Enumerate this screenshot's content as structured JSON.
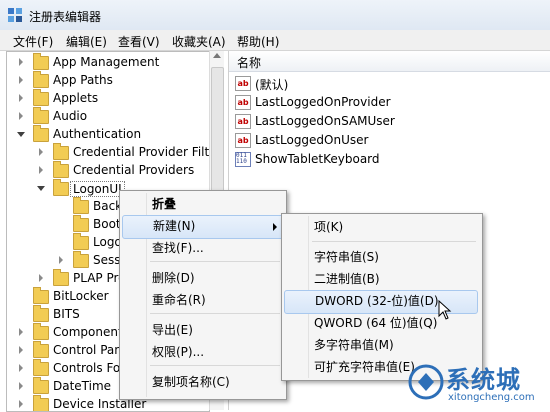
{
  "window": {
    "title": "注册表编辑器"
  },
  "menubar": [
    "文件(F)",
    "编辑(E)",
    "查看(V)",
    "收藏夹(A)",
    "帮助(H)"
  ],
  "tree": {
    "items": [
      {
        "label": "App Management",
        "level": 1,
        "state": "collapsed"
      },
      {
        "label": "App Paths",
        "level": 1,
        "state": "collapsed"
      },
      {
        "label": "Applets",
        "level": 1,
        "state": "collapsed"
      },
      {
        "label": "Audio",
        "level": 1,
        "state": "collapsed"
      },
      {
        "label": "Authentication",
        "level": 1,
        "state": "expanded"
      },
      {
        "label": "Credential Provider Filter",
        "level": 2,
        "state": "collapsed"
      },
      {
        "label": "Credential Providers",
        "level": 2,
        "state": "collapsed"
      },
      {
        "label": "LogonUI",
        "level": 2,
        "state": "expanded",
        "selected": true
      },
      {
        "label": "Back",
        "level": 3,
        "state": "none"
      },
      {
        "label": "Boot",
        "level": 3,
        "state": "none"
      },
      {
        "label": "Logo",
        "level": 3,
        "state": "none"
      },
      {
        "label": "Sessi",
        "level": 3,
        "state": "collapsed"
      },
      {
        "label": "PLAP Pro",
        "level": 2,
        "state": "collapsed"
      },
      {
        "label": "BitLocker",
        "level": 1,
        "state": "none"
      },
      {
        "label": "BITS",
        "level": 1,
        "state": "none"
      },
      {
        "label": "Component",
        "level": 1,
        "state": "collapsed"
      },
      {
        "label": "Control Pan",
        "level": 1,
        "state": "collapsed"
      },
      {
        "label": "Controls Fol",
        "level": 1,
        "state": "collapsed"
      },
      {
        "label": "DateTime",
        "level": 1,
        "state": "collapsed"
      },
      {
        "label": "Device Installer",
        "level": 1,
        "state": "collapsed"
      }
    ]
  },
  "values_pane": {
    "column_header": "名称",
    "rows": [
      {
        "name": "(默认)",
        "type": "string"
      },
      {
        "name": "LastLoggedOnProvider",
        "type": "string"
      },
      {
        "name": "LastLoggedOnSAMUser",
        "type": "string"
      },
      {
        "name": "LastLoggedOnUser",
        "type": "string"
      },
      {
        "name": "ShowTabletKeyboard",
        "type": "binary"
      }
    ]
  },
  "context_menu": {
    "items": [
      {
        "label": "折叠",
        "bold": true
      },
      {
        "label": "新建(N)",
        "has_submenu": true,
        "highlighted": true
      },
      {
        "label": "查找(F)..."
      },
      {
        "label": "删除(D)"
      },
      {
        "label": "重命名(R)"
      },
      {
        "label": "导出(E)"
      },
      {
        "label": "权限(P)..."
      },
      {
        "label": "复制项名称(C)"
      }
    ]
  },
  "submenu": {
    "items": [
      {
        "label": "项(K)"
      },
      {
        "label": "字符串值(S)"
      },
      {
        "label": "二进制值(B)"
      },
      {
        "label": "DWORD (32-位)值(D)",
        "highlighted": true
      },
      {
        "label": "QWORD (64 位)值(Q)"
      },
      {
        "label": "多字符串值(M)"
      },
      {
        "label": "可扩充字符串值(E)"
      }
    ]
  },
  "watermark": {
    "text": "系统城",
    "url": "xitongcheng.com"
  },
  "colors": {
    "folder": "#f2cc54",
    "menu_highlight": "#d7e6f8",
    "watermark": "#2d6fb8"
  }
}
